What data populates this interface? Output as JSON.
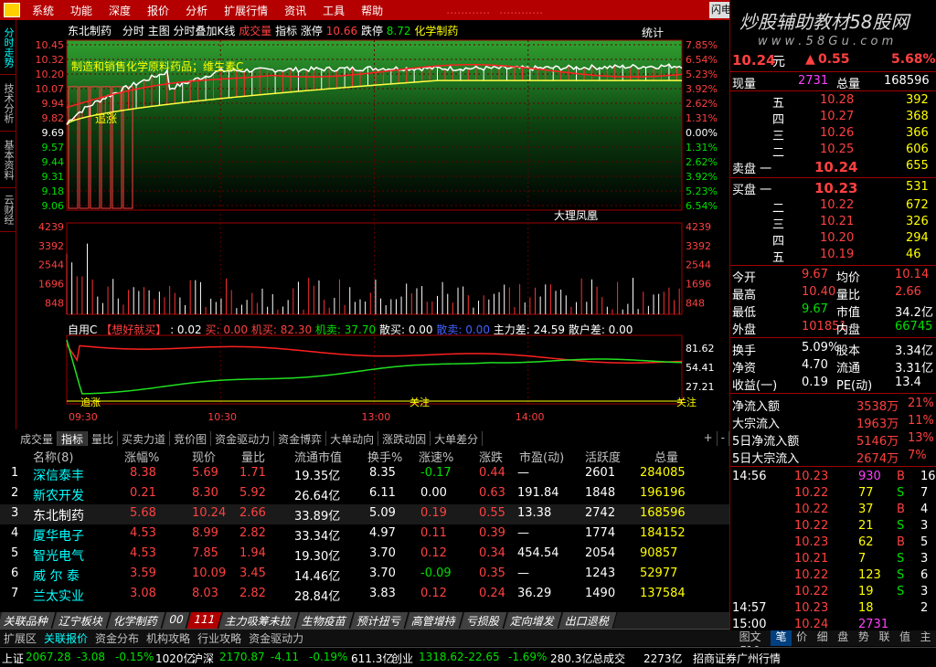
{
  "menu": {
    "items": [
      "系统",
      "功能",
      "深度",
      "报价",
      "分析",
      "扩展行情",
      "资讯",
      "工具",
      "帮助"
    ],
    "warn1": "…………",
    "warn2": "…………",
    "window_btn": "闪电"
  },
  "left_tabs": [
    "分时走势",
    "技术分析",
    "基本资料",
    "云财经"
  ],
  "chart_header": {
    "stock": "东北制药",
    "items": [
      "分时",
      "主图",
      "分时叠加K线",
      "成交量",
      "指标",
      "涨停"
    ],
    "limit_up": "10.66",
    "limit_down_label": "跌停",
    "limit_down": "8.72",
    "sector": "化学制药",
    "stats": "统计"
  },
  "annotation": {
    "news": "制造和销售化学原料药品；维生素C",
    "tag1": "追涨",
    "watermark": "大理凤凰"
  },
  "watermark_site": "炒股辅助教材58股网",
  "watermark_url": "w w w . 5 8 G u . c o m",
  "price_axis": {
    "left": [
      "10.45",
      "10.32",
      "10.20",
      "10.07",
      "9.94",
      "9.82",
      "9.69",
      "9.57",
      "9.44",
      "9.31",
      "9.18",
      "9.06"
    ],
    "right": [
      "7.85%",
      "6.54%",
      "5.23%",
      "3.92%",
      "2.62%",
      "1.31%",
      "0.00%",
      "1.31%",
      "2.62%",
      "3.92%",
      "5.23%",
      "6.54%"
    ]
  },
  "vol_axis": [
    "4239",
    "3392",
    "2544",
    "1696",
    "848"
  ],
  "indicator": {
    "label": "自用C",
    "name": "【想好就买】",
    "v1": ": 0.02",
    "v2": "买: 0.00",
    "v3": "机买: 82.30",
    "v4": "机卖: 37.70",
    "v5": "散买: 0.00",
    "v6": "散卖: 0.00",
    "v7": "主力差: 24.59",
    "v8": "散户差: 0.00",
    "axis": [
      "81.62",
      "54.41",
      "27.21"
    ],
    "mark1": "追涨",
    "mark2": "关注",
    "mark3": "关注"
  },
  "time_axis": [
    "09:30",
    "10:30",
    "13:00",
    "14:00"
  ],
  "chart_tabs": [
    "成交量",
    "指标",
    "量比",
    "买卖力道",
    "竞价图",
    "资金驱动力",
    "资金博弈",
    "大单动向",
    "涨跌动因",
    "大单差分"
  ],
  "chart_tab_misc": [
    "+",
    "-"
  ],
  "chart_data": {
    "type": "line",
    "x": [
      "09:30",
      "10:30",
      "13:00",
      "14:00",
      "15:00"
    ],
    "series": [
      {
        "values": [
          9.76,
          10.2,
          10.22,
          10.22,
          10.24
        ]
      }
    ],
    "ylim": [
      9.06,
      10.45
    ]
  },
  "quote": {
    "price": "10.24",
    "unit": "元",
    "change": "0.55",
    "pct": "5.68%",
    "vol_label": "现量",
    "vol": "2731",
    "total_label": "总量",
    "total": "168596",
    "sell": [
      {
        "l": "五",
        "p": "10.28",
        "v": "392"
      },
      {
        "l": "四",
        "p": "10.27",
        "v": "368"
      },
      {
        "l": "三",
        "p": "10.26",
        "v": "366"
      },
      {
        "l": "二",
        "p": "10.25",
        "v": "606"
      },
      {
        "l": "卖盘 一",
        "p": "10.24",
        "v": "655"
      }
    ],
    "buy": [
      {
        "l": "买盘 一",
        "p": "10.23",
        "v": "531"
      },
      {
        "l": "二",
        "p": "10.22",
        "v": "672"
      },
      {
        "l": "三",
        "p": "10.21",
        "v": "326"
      },
      {
        "l": "四",
        "p": "10.20",
        "v": "294"
      },
      {
        "l": "五",
        "p": "10.19",
        "v": "46"
      }
    ],
    "stats": [
      [
        "今开",
        "9.67",
        "均价",
        "10.14"
      ],
      [
        "最高",
        "10.40",
        "量比",
        "2.66"
      ],
      [
        "最低",
        "9.67",
        "市值",
        "34.2亿"
      ],
      [
        "外盘",
        "101851",
        "内盘",
        "66745"
      ]
    ],
    "fund": [
      [
        "换手",
        "5.09%",
        "股本",
        "3.34亿"
      ],
      [
        "净资",
        "4.70",
        "流通",
        "3.31亿"
      ],
      [
        "收益(一)",
        "0.19",
        "PE(动)",
        "13.4"
      ]
    ],
    "flow": [
      [
        "净流入额",
        "3538万",
        "21%"
      ],
      [
        "大宗流入",
        "1963万",
        "11%"
      ],
      [
        "5日净流入额",
        "5146万",
        "13%"
      ],
      [
        "5日大宗流入",
        "2674万",
        "7%"
      ]
    ],
    "ticks": [
      [
        "14:56",
        "10.23",
        "930",
        "B",
        "16"
      ],
      [
        "",
        "10.22",
        "77",
        "S",
        "7"
      ],
      [
        "",
        "10.22",
        "37",
        "B",
        "4"
      ],
      [
        "",
        "10.22",
        "21",
        "S",
        "3"
      ],
      [
        "",
        "10.23",
        "62",
        "B",
        "5"
      ],
      [
        "",
        "10.21",
        "7",
        "S",
        "3"
      ],
      [
        "",
        "10.22",
        "123",
        "S",
        "6"
      ],
      [
        "",
        "10.22",
        "19",
        "S",
        "3"
      ],
      [
        "14:57",
        "10.23",
        "18",
        "",
        "2"
      ],
      [
        "15:00",
        "10.24",
        "2731",
        "",
        ""
      ]
    ]
  },
  "table": {
    "headers": [
      "名称(8)",
      "涨幅%",
      "现价",
      "量比",
      "流通市值",
      "换手%",
      "涨速%",
      "涨跌",
      "市盈(动)",
      "活跃度",
      "总量"
    ],
    "rows": [
      [
        "1",
        "深信泰丰",
        "8.38",
        "5.69",
        "1.71",
        "19.35亿",
        "8.35",
        "-0.17",
        "0.44",
        "—",
        "2601",
        "284085"
      ],
      [
        "2",
        "新农开发",
        "0.21",
        "8.30",
        "5.92",
        "26.64亿",
        "6.11",
        "0.00",
        "0.63",
        "191.84",
        "1848",
        "196196"
      ],
      [
        "3",
        "东北制药",
        "5.68",
        "10.24",
        "2.66",
        "33.89亿",
        "5.09",
        "0.19",
        "0.55",
        "13.38",
        "2742",
        "168596"
      ],
      [
        "4",
        "厦华电子",
        "4.53",
        "8.99",
        "2.82",
        "33.34亿",
        "4.97",
        "0.11",
        "0.39",
        "—",
        "1774",
        "184152"
      ],
      [
        "5",
        "智光电气",
        "4.53",
        "7.85",
        "1.94",
        "19.30亿",
        "3.70",
        "0.12",
        "0.34",
        "454.54",
        "2054",
        "90857"
      ],
      [
        "6",
        "威 尔 泰",
        "3.59",
        "10.09",
        "3.45",
        "14.46亿",
        "3.70",
        "-0.09",
        "0.35",
        "—",
        "1243",
        "52977"
      ],
      [
        "7",
        "兰太实业",
        "3.08",
        "8.03",
        "2.82",
        "28.84亿",
        "3.83",
        "0.12",
        "0.24",
        "36.29",
        "1490",
        "137584"
      ]
    ]
  },
  "bottom_tabs": [
    "关联品种",
    "辽宁板块",
    "化学制药",
    "00",
    "111",
    "主力吸筹未拉",
    "生物疫苗",
    "预计扭亏",
    "高管增持",
    "亏损股",
    "定向增发",
    "出口退税"
  ],
  "bottom_tabs2": [
    "扩展区",
    "关联报价",
    "资金分布",
    "机构攻略",
    "行业攻略",
    "资金驱动力"
  ],
  "right_tabs_label": "图文F10",
  "right_tabs": [
    "笔",
    "价",
    "细",
    "盘",
    "势",
    "联",
    "值",
    "主"
  ],
  "status": {
    "sh_label": "上证",
    "sh": "2067.28",
    "sh_ch": "-3.08",
    "sh_pct": "-0.15%",
    "sh_amt": "1020亿",
    "sz_label": "沪深",
    "sz": "2170.87",
    "sz_ch": "-4.11",
    "sz_pct": "-0.19%",
    "sz_amt": "611.3亿",
    "cy_label": "创业",
    "cy": "1318.62",
    "cy_ch": "-22.65",
    "cy_pct": "-1.69%",
    "cy_amt": "280.3亿",
    "total_label": "总成交",
    "total": "2273亿",
    "broker": "招商证券广州行情"
  }
}
